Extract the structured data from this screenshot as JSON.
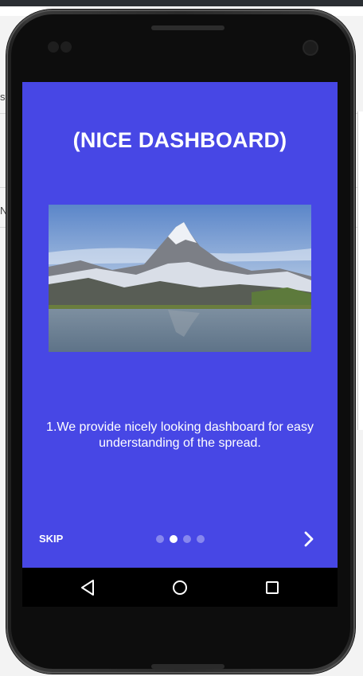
{
  "app": {
    "title": "(NICE DASHBOARD)",
    "hero_image": "mountain-lake-photo",
    "description": "1.We provide nicely looking dashboard for easy understanding of the spread.",
    "skip_label": "SKIP",
    "pager": {
      "total": 4,
      "active_index": 1
    },
    "next_icon": "chevron-right-icon"
  },
  "system_nav": {
    "back_icon": "back-triangle-icon",
    "home_icon": "home-circle-icon",
    "recents_icon": "recents-square-icon"
  },
  "background": {
    "letter_s": "s",
    "letter_n": "N"
  },
  "colors": {
    "accent": "#4747e5",
    "nav_bar": "#000000",
    "text": "#ffffff"
  }
}
